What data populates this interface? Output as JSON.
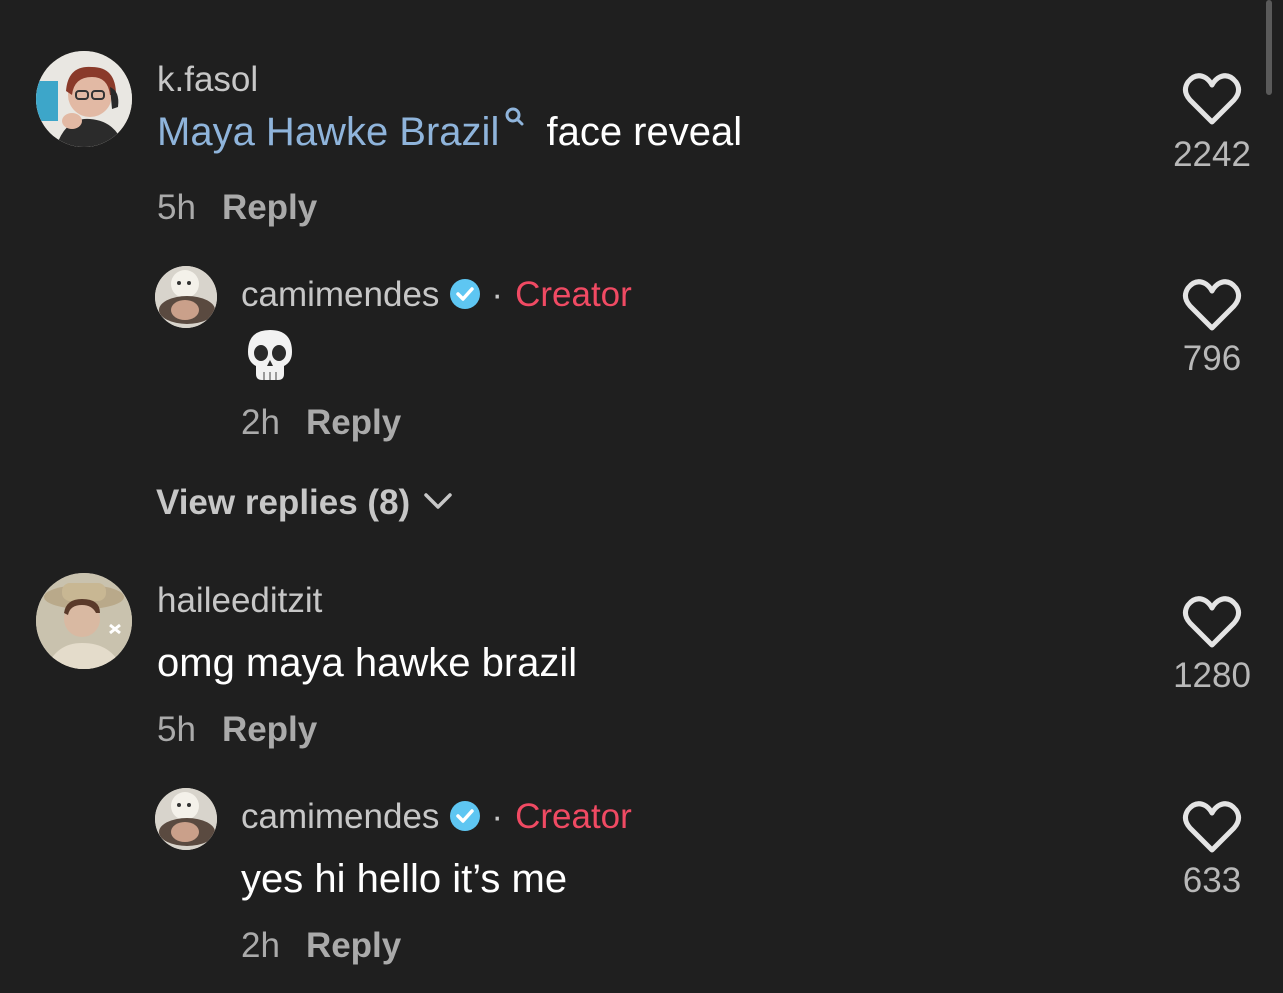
{
  "comments": [
    {
      "username": "k.fasol",
      "mention": "Maya Hawke Brazil",
      "text": "face reveal",
      "time": "5h",
      "reply_label": "Reply",
      "likes": "2242",
      "avatar_icon": "avatar-photo"
    },
    {
      "username": "camimendes",
      "badge": "verified-icon",
      "separator": "·",
      "creator_label": "Creator",
      "text_emoji": "skull-emoji",
      "time": "2h",
      "reply_label": "Reply",
      "likes": "796",
      "avatar_icon": "avatar-photo"
    },
    {
      "username": "haileeditzit",
      "text": "omg maya hawke brazil",
      "time": "5h",
      "reply_label": "Reply",
      "likes": "1280",
      "avatar_icon": "avatar-photo"
    },
    {
      "username": "camimendes",
      "badge": "verified-icon",
      "separator": "·",
      "creator_label": "Creator",
      "text": "yes hi hello it’s me",
      "time": "2h",
      "reply_label": "Reply",
      "likes": "633",
      "avatar_icon": "avatar-photo"
    }
  ],
  "view_replies": {
    "label": "View replies (8)",
    "icon": "chevron-down-icon"
  },
  "colors": {
    "background": "#1f1f1f",
    "mention": "#8fb4db",
    "creator": "#f04a63",
    "verified": "#5ec6f2",
    "secondary_text": "#aaaaaa"
  }
}
